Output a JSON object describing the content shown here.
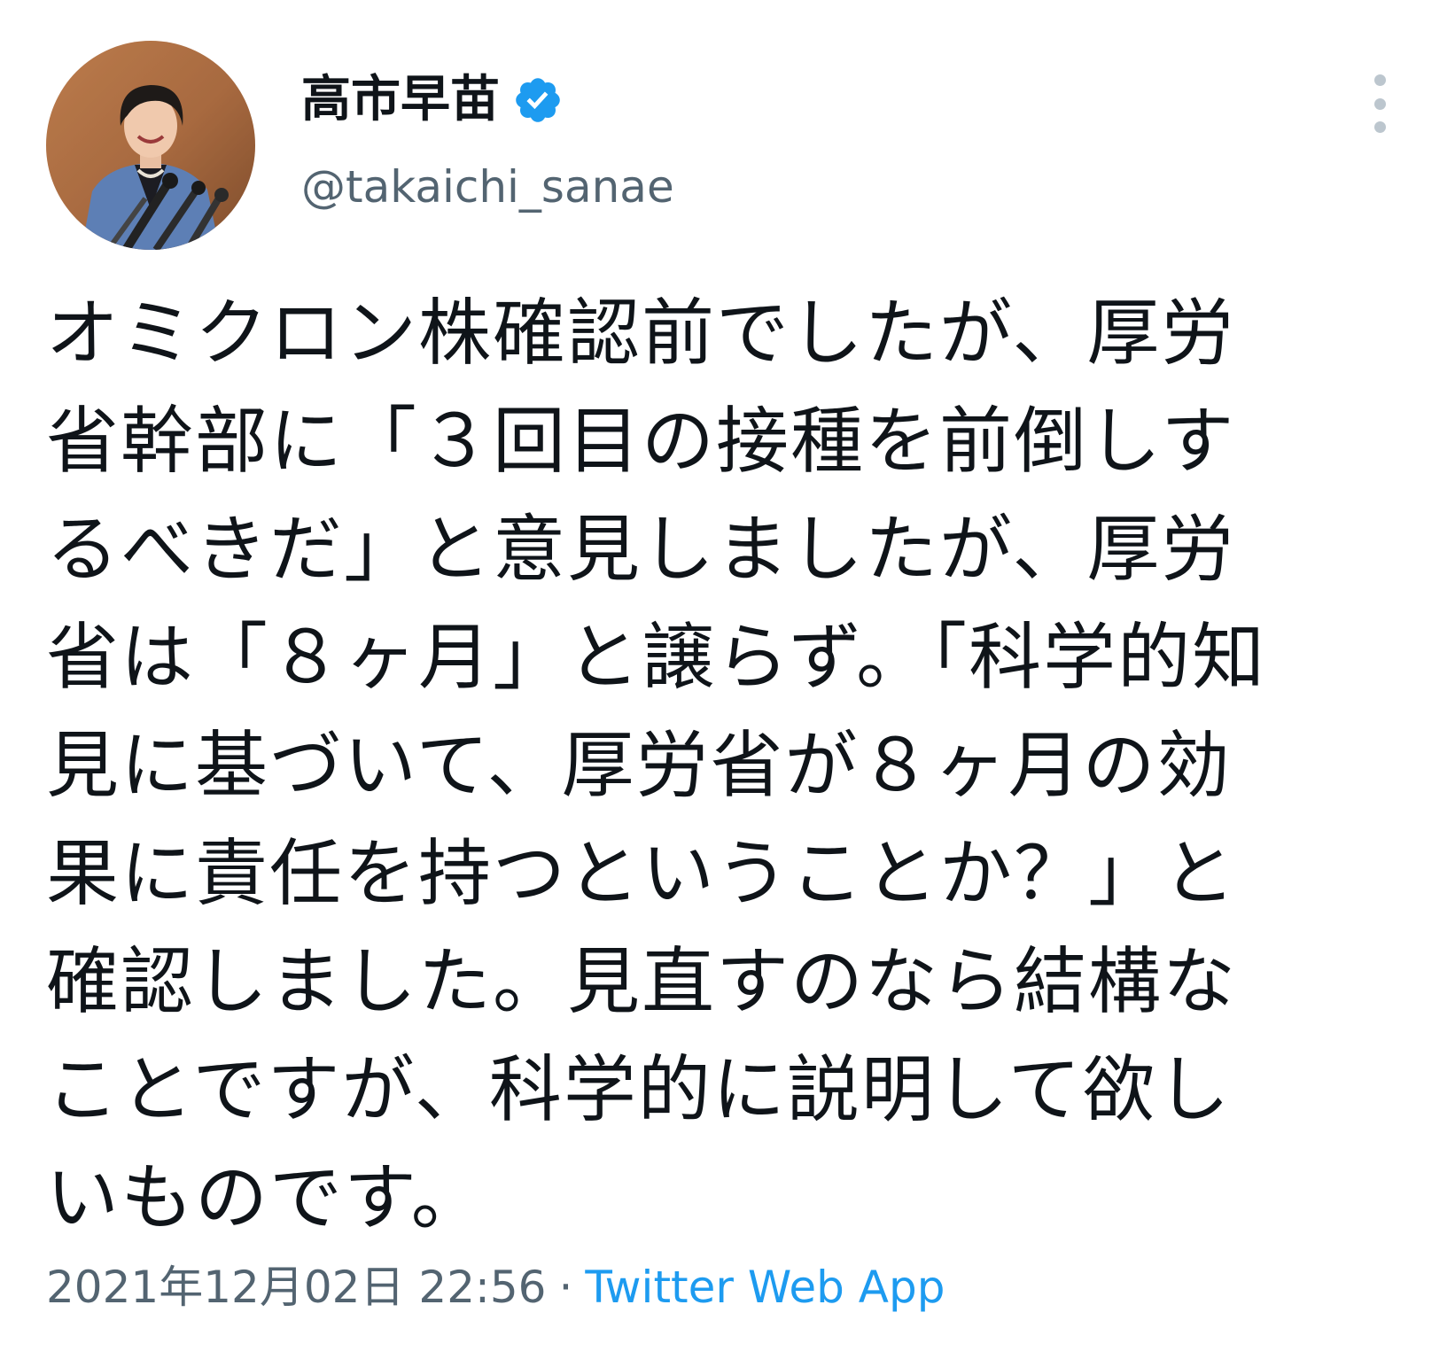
{
  "author": {
    "display_name": "高市早苗",
    "handle": "@takaichi_sanae",
    "verified": true
  },
  "tweet": {
    "lines": [
      "オミクロン株確認前でしたが、厚労",
      "省幹部に「３回目の接種を前倒しす",
      "るべきだ」と意見しましたが、厚労",
      "省は「８ヶ月」と譲らず。「科学的知",
      "見に基づいて、厚労省が８ヶ月の効",
      "果に責任を持つということか？」と",
      "確認しました。見直すのなら結構な",
      "ことですが、科学的に説明して欲し",
      "いものです。"
    ]
  },
  "meta": {
    "timestamp": "2021年12月02日 22:56",
    "separator": "·",
    "source": "Twitter Web App"
  },
  "icons": {
    "verified": "verified-badge-icon",
    "more": "more-options-icon"
  },
  "colors": {
    "accent": "#1d9bf0",
    "secondary_text": "#536471",
    "primary_text": "#0f1419"
  }
}
